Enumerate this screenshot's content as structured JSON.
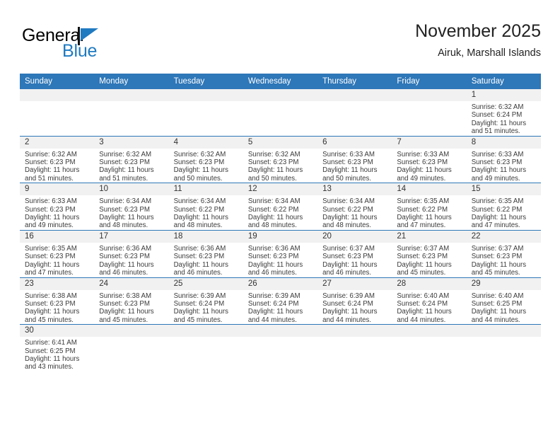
{
  "logo": {
    "word_top": "General",
    "word_bottom": "Blue",
    "flag_color": "#1f7ac0",
    "icon": "triangle-flag-icon"
  },
  "header": {
    "title": "November 2025",
    "subtitle": "Airuk, Marshall Islands"
  },
  "colors": {
    "header_blue": "#2e77b8",
    "daynum_gray": "#f1f1f1",
    "text": "#3b3b3b"
  },
  "weekday_headers": [
    "Sunday",
    "Monday",
    "Tuesday",
    "Wednesday",
    "Thursday",
    "Friday",
    "Saturday"
  ],
  "weeks": [
    [
      {
        "day": "",
        "l1": "",
        "l2": "",
        "l3": "",
        "l4": ""
      },
      {
        "day": "",
        "l1": "",
        "l2": "",
        "l3": "",
        "l4": ""
      },
      {
        "day": "",
        "l1": "",
        "l2": "",
        "l3": "",
        "l4": ""
      },
      {
        "day": "",
        "l1": "",
        "l2": "",
        "l3": "",
        "l4": ""
      },
      {
        "day": "",
        "l1": "",
        "l2": "",
        "l3": "",
        "l4": ""
      },
      {
        "day": "",
        "l1": "",
        "l2": "",
        "l3": "",
        "l4": ""
      },
      {
        "day": "1",
        "l1": "Sunrise: 6:32 AM",
        "l2": "Sunset: 6:24 PM",
        "l3": "Daylight: 11 hours",
        "l4": "and 51 minutes."
      }
    ],
    [
      {
        "day": "2",
        "l1": "Sunrise: 6:32 AM",
        "l2": "Sunset: 6:23 PM",
        "l3": "Daylight: 11 hours",
        "l4": "and 51 minutes."
      },
      {
        "day": "3",
        "l1": "Sunrise: 6:32 AM",
        "l2": "Sunset: 6:23 PM",
        "l3": "Daylight: 11 hours",
        "l4": "and 51 minutes."
      },
      {
        "day": "4",
        "l1": "Sunrise: 6:32 AM",
        "l2": "Sunset: 6:23 PM",
        "l3": "Daylight: 11 hours",
        "l4": "and 50 minutes."
      },
      {
        "day": "5",
        "l1": "Sunrise: 6:32 AM",
        "l2": "Sunset: 6:23 PM",
        "l3": "Daylight: 11 hours",
        "l4": "and 50 minutes."
      },
      {
        "day": "6",
        "l1": "Sunrise: 6:33 AM",
        "l2": "Sunset: 6:23 PM",
        "l3": "Daylight: 11 hours",
        "l4": "and 50 minutes."
      },
      {
        "day": "7",
        "l1": "Sunrise: 6:33 AM",
        "l2": "Sunset: 6:23 PM",
        "l3": "Daylight: 11 hours",
        "l4": "and 49 minutes."
      },
      {
        "day": "8",
        "l1": "Sunrise: 6:33 AM",
        "l2": "Sunset: 6:23 PM",
        "l3": "Daylight: 11 hours",
        "l4": "and 49 minutes."
      }
    ],
    [
      {
        "day": "9",
        "l1": "Sunrise: 6:33 AM",
        "l2": "Sunset: 6:23 PM",
        "l3": "Daylight: 11 hours",
        "l4": "and 49 minutes."
      },
      {
        "day": "10",
        "l1": "Sunrise: 6:34 AM",
        "l2": "Sunset: 6:23 PM",
        "l3": "Daylight: 11 hours",
        "l4": "and 48 minutes."
      },
      {
        "day": "11",
        "l1": "Sunrise: 6:34 AM",
        "l2": "Sunset: 6:22 PM",
        "l3": "Daylight: 11 hours",
        "l4": "and 48 minutes."
      },
      {
        "day": "12",
        "l1": "Sunrise: 6:34 AM",
        "l2": "Sunset: 6:22 PM",
        "l3": "Daylight: 11 hours",
        "l4": "and 48 minutes."
      },
      {
        "day": "13",
        "l1": "Sunrise: 6:34 AM",
        "l2": "Sunset: 6:22 PM",
        "l3": "Daylight: 11 hours",
        "l4": "and 48 minutes."
      },
      {
        "day": "14",
        "l1": "Sunrise: 6:35 AM",
        "l2": "Sunset: 6:22 PM",
        "l3": "Daylight: 11 hours",
        "l4": "and 47 minutes."
      },
      {
        "day": "15",
        "l1": "Sunrise: 6:35 AM",
        "l2": "Sunset: 6:22 PM",
        "l3": "Daylight: 11 hours",
        "l4": "and 47 minutes."
      }
    ],
    [
      {
        "day": "16",
        "l1": "Sunrise: 6:35 AM",
        "l2": "Sunset: 6:23 PM",
        "l3": "Daylight: 11 hours",
        "l4": "and 47 minutes."
      },
      {
        "day": "17",
        "l1": "Sunrise: 6:36 AM",
        "l2": "Sunset: 6:23 PM",
        "l3": "Daylight: 11 hours",
        "l4": "and 46 minutes."
      },
      {
        "day": "18",
        "l1": "Sunrise: 6:36 AM",
        "l2": "Sunset: 6:23 PM",
        "l3": "Daylight: 11 hours",
        "l4": "and 46 minutes."
      },
      {
        "day": "19",
        "l1": "Sunrise: 6:36 AM",
        "l2": "Sunset: 6:23 PM",
        "l3": "Daylight: 11 hours",
        "l4": "and 46 minutes."
      },
      {
        "day": "20",
        "l1": "Sunrise: 6:37 AM",
        "l2": "Sunset: 6:23 PM",
        "l3": "Daylight: 11 hours",
        "l4": "and 46 minutes."
      },
      {
        "day": "21",
        "l1": "Sunrise: 6:37 AM",
        "l2": "Sunset: 6:23 PM",
        "l3": "Daylight: 11 hours",
        "l4": "and 45 minutes."
      },
      {
        "day": "22",
        "l1": "Sunrise: 6:37 AM",
        "l2": "Sunset: 6:23 PM",
        "l3": "Daylight: 11 hours",
        "l4": "and 45 minutes."
      }
    ],
    [
      {
        "day": "23",
        "l1": "Sunrise: 6:38 AM",
        "l2": "Sunset: 6:23 PM",
        "l3": "Daylight: 11 hours",
        "l4": "and 45 minutes."
      },
      {
        "day": "24",
        "l1": "Sunrise: 6:38 AM",
        "l2": "Sunset: 6:23 PM",
        "l3": "Daylight: 11 hours",
        "l4": "and 45 minutes."
      },
      {
        "day": "25",
        "l1": "Sunrise: 6:39 AM",
        "l2": "Sunset: 6:24 PM",
        "l3": "Daylight: 11 hours",
        "l4": "and 45 minutes."
      },
      {
        "day": "26",
        "l1": "Sunrise: 6:39 AM",
        "l2": "Sunset: 6:24 PM",
        "l3": "Daylight: 11 hours",
        "l4": "and 44 minutes."
      },
      {
        "day": "27",
        "l1": "Sunrise: 6:39 AM",
        "l2": "Sunset: 6:24 PM",
        "l3": "Daylight: 11 hours",
        "l4": "and 44 minutes."
      },
      {
        "day": "28",
        "l1": "Sunrise: 6:40 AM",
        "l2": "Sunset: 6:24 PM",
        "l3": "Daylight: 11 hours",
        "l4": "and 44 minutes."
      },
      {
        "day": "29",
        "l1": "Sunrise: 6:40 AM",
        "l2": "Sunset: 6:25 PM",
        "l3": "Daylight: 11 hours",
        "l4": "and 44 minutes."
      }
    ],
    [
      {
        "day": "30",
        "l1": "Sunrise: 6:41 AM",
        "l2": "Sunset: 6:25 PM",
        "l3": "Daylight: 11 hours",
        "l4": "and 43 minutes."
      },
      {
        "day": "",
        "l1": "",
        "l2": "",
        "l3": "",
        "l4": ""
      },
      {
        "day": "",
        "l1": "",
        "l2": "",
        "l3": "",
        "l4": ""
      },
      {
        "day": "",
        "l1": "",
        "l2": "",
        "l3": "",
        "l4": ""
      },
      {
        "day": "",
        "l1": "",
        "l2": "",
        "l3": "",
        "l4": ""
      },
      {
        "day": "",
        "l1": "",
        "l2": "",
        "l3": "",
        "l4": ""
      },
      {
        "day": "",
        "l1": "",
        "l2": "",
        "l3": "",
        "l4": ""
      }
    ]
  ]
}
